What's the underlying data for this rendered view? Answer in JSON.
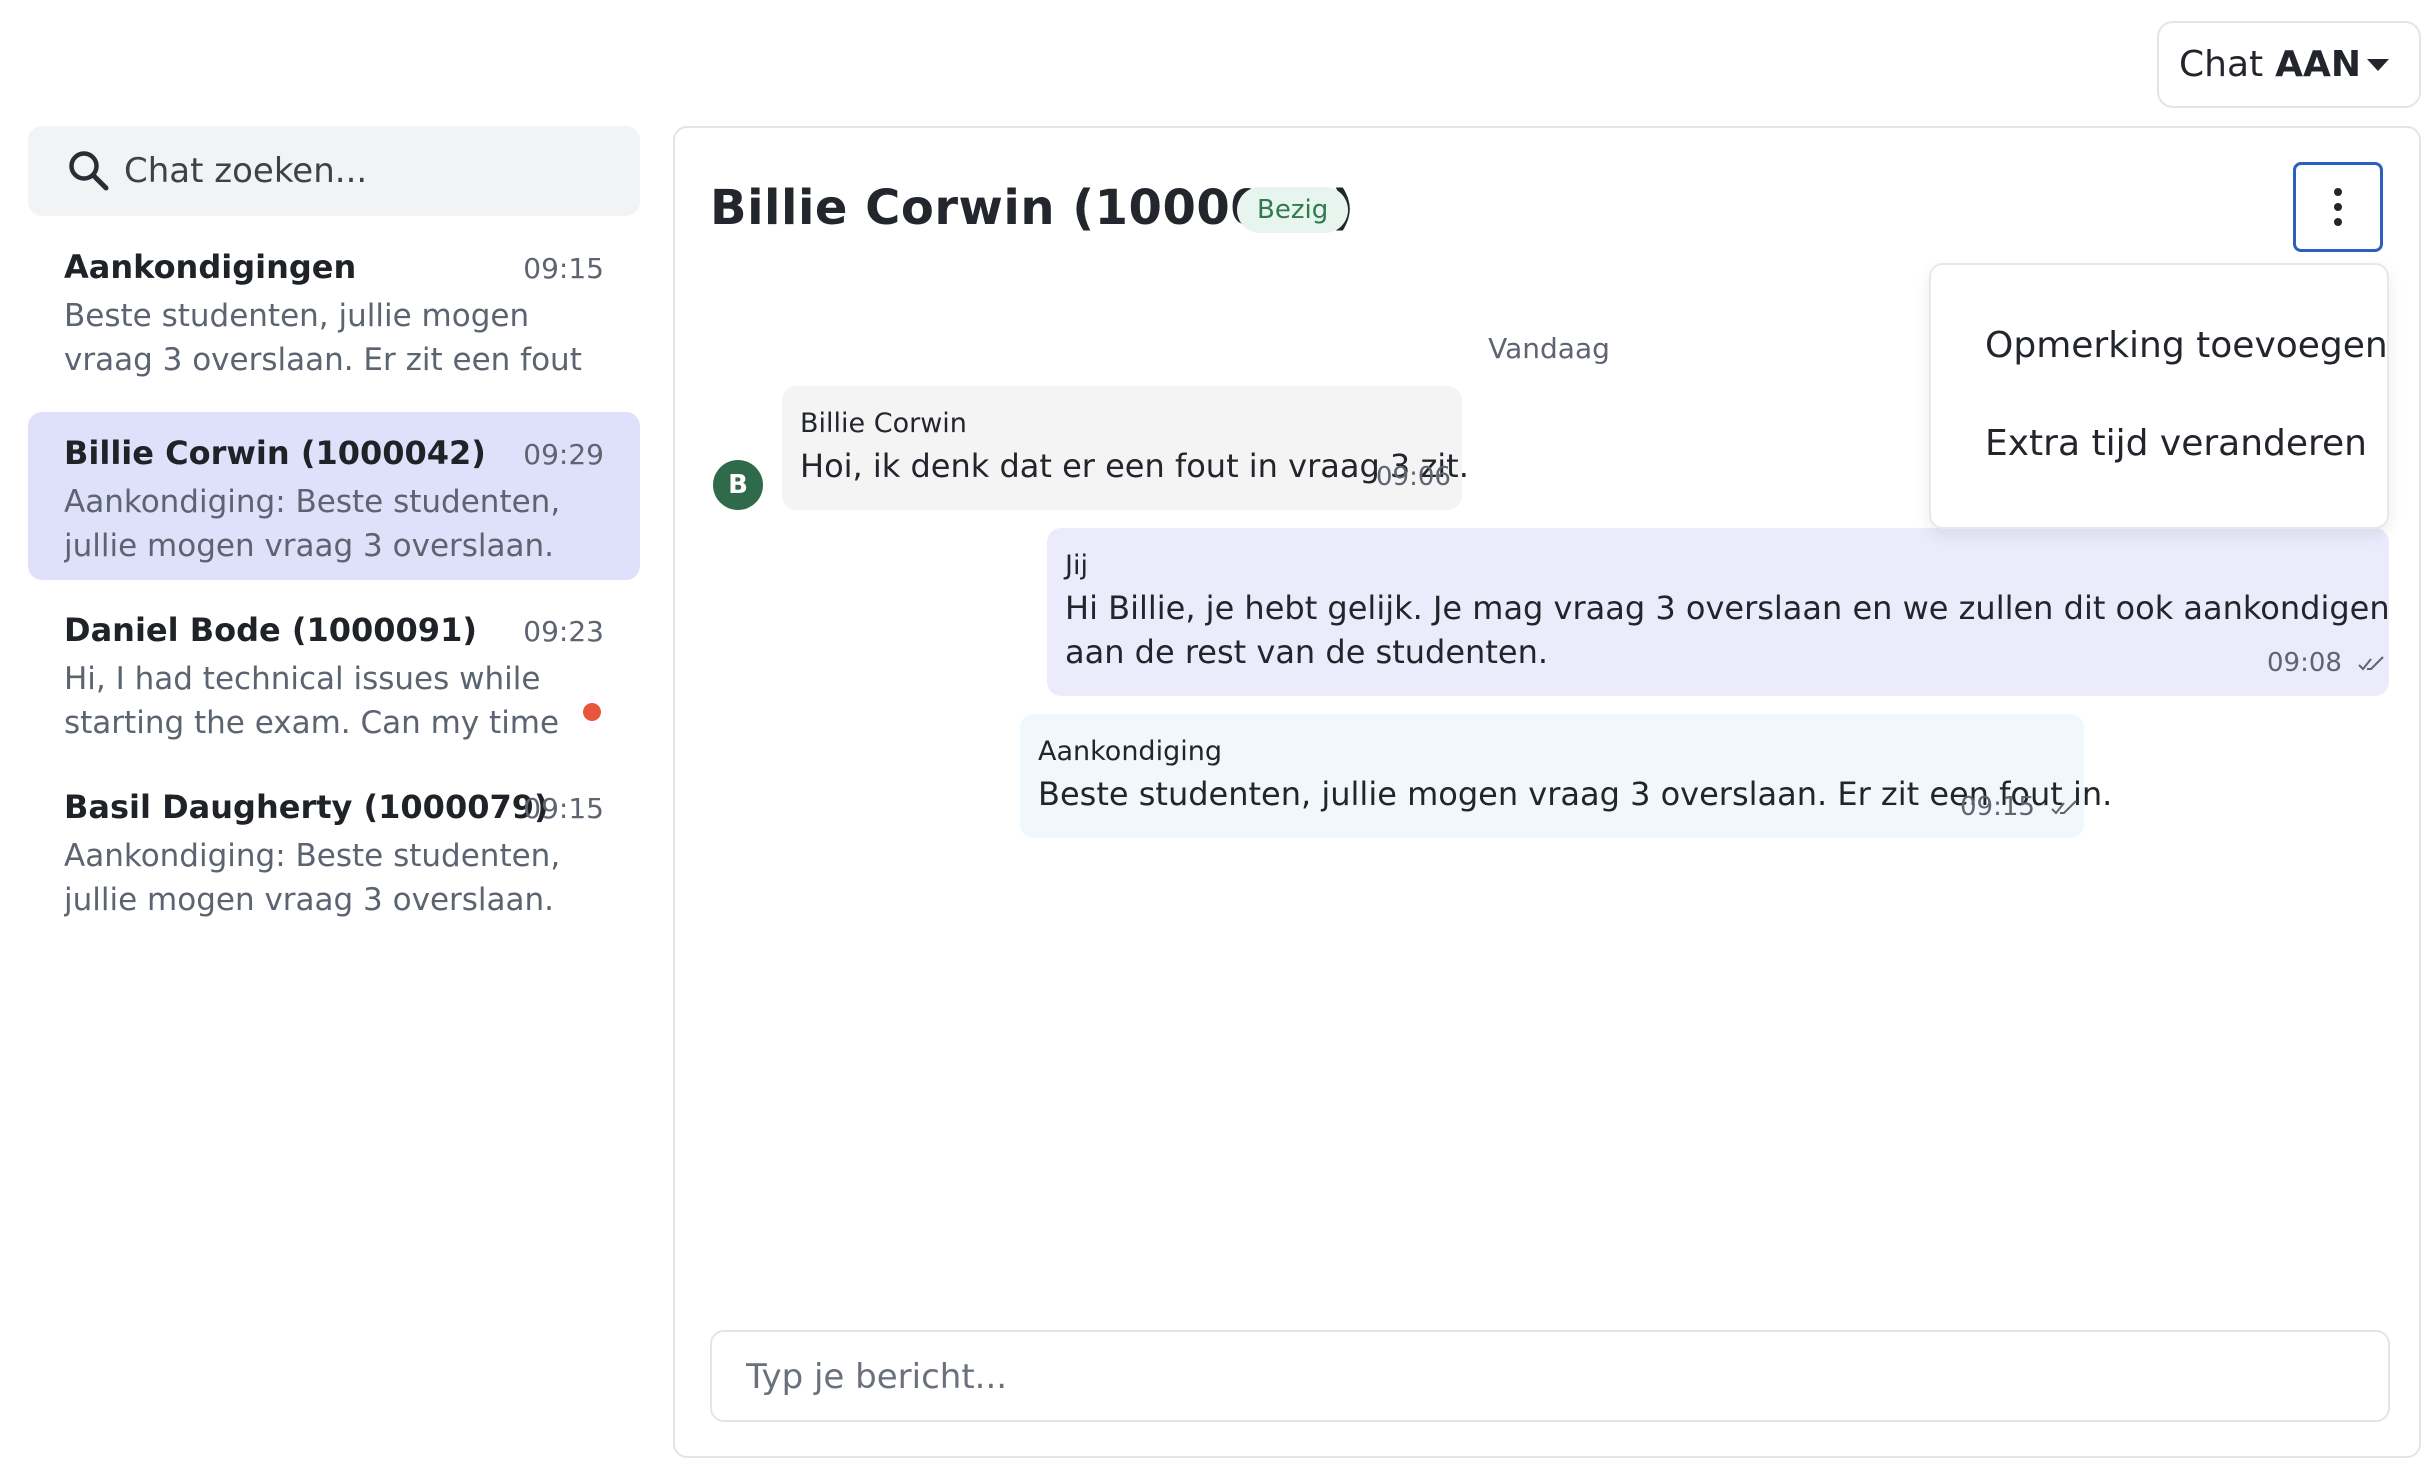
{
  "top": {
    "chat_label": "Chat",
    "chat_value": "AAN"
  },
  "sidebar": {
    "search_placeholder": "Chat zoeken...",
    "chats": [
      {
        "name": "Aankondigingen",
        "time": "09:15",
        "preview": "Beste studenten, jullie mogen vraag 3 overslaan. Er zit een fout in."
      },
      {
        "name": "Billie Corwin (1000042)",
        "time": "09:29",
        "preview": "Aankondiging: Beste studenten, jullie mogen vraag 3 overslaan. Er zit een...",
        "active": true
      },
      {
        "name": "Daniel Bode (1000091)",
        "time": "09:23",
        "preview": "Hi, I had technical issues while starting the exam. Can my time be...",
        "unread": true
      },
      {
        "name": "Basil Daugherty (1000079)",
        "time": "09:15",
        "preview": "Aankondiging: Beste studenten, jullie mogen vraag 3 overslaan. Er zit een..."
      }
    ]
  },
  "conversation": {
    "title": "Billie Corwin (1000042)",
    "status": "Bezig",
    "menu": {
      "items": [
        "Opmerking toevoegen",
        "Extra tijd veranderen"
      ]
    },
    "date_divider": "Vandaag",
    "avatar_initial": "B",
    "messages": [
      {
        "sender": "Billie Corwin",
        "line1": "Hoi, ik denk dat er een fout in vraag 3 zit.",
        "time": "09:06"
      },
      {
        "sender": "Jij",
        "line1": "Hi Billie, je hebt gelijk. Je mag vraag 3 overslaan en we zullen dit ook aankondigen",
        "line2": "aan de rest van de studenten.",
        "time": "09:08"
      },
      {
        "sender": "Aankondiging",
        "line1": "Beste studenten, jullie mogen vraag 3 overslaan. Er zit een fout in.",
        "time": "09:15"
      }
    ],
    "input_placeholder": "Typ je bericht..."
  },
  "colors": {
    "active_chat_bg": "#dfe1fb",
    "unread_dot": "#e8553a",
    "status_badge_bg": "#e8f5ee",
    "status_badge_text": "#2f7a4f",
    "menu_button_border": "#2c5fbf",
    "avatar_bg": "#2f6a4a",
    "incoming_bg": "#f4f4f5",
    "outgoing_bg": "#ebebfb",
    "announcement_bg": "#f0f8fc"
  },
  "icons": {
    "search": "search-icon",
    "caret": "chevron-down-icon",
    "menu": "more-vertical-icon",
    "read_receipt": "double-check-icon"
  }
}
